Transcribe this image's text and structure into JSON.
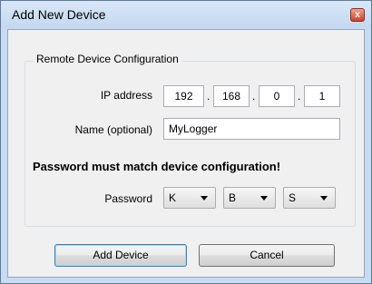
{
  "window": {
    "title": "Add New Device",
    "close_glyph": "x"
  },
  "group": {
    "legend": "Remote Device Configuration"
  },
  "ip": {
    "label": "IP address",
    "octets": [
      "192",
      "168",
      "0",
      "1"
    ],
    "separator": "."
  },
  "name": {
    "label": "Name (optional)",
    "value": "MyLogger"
  },
  "warning": "Password must match device configuration!",
  "password": {
    "label": "Password",
    "values": [
      "K",
      "B",
      "S"
    ]
  },
  "buttons": {
    "add": "Add Device",
    "cancel": "Cancel"
  },
  "icons": {
    "close": "close-icon",
    "dropdown": "chevron-down-icon"
  },
  "colors": {
    "title_bar": "#c8dbf1",
    "close_button": "#c9442a",
    "default_button_border": "#3c7fb1"
  }
}
